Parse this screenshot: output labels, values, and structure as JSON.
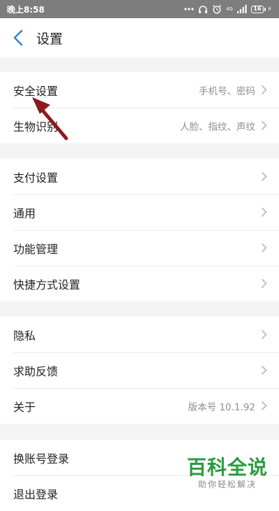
{
  "status_bar": {
    "time": "晚上8:58",
    "battery": "16",
    "network": "4G"
  },
  "header": {
    "title": "设置"
  },
  "groups": [
    {
      "items": [
        {
          "label": "安全设置",
          "value": "手机号、密码"
        },
        {
          "label": "生物识别",
          "value": "人脸、指纹、声纹"
        }
      ]
    },
    {
      "items": [
        {
          "label": "支付设置",
          "value": ""
        },
        {
          "label": "通用",
          "value": ""
        },
        {
          "label": "功能管理",
          "value": ""
        },
        {
          "label": "快捷方式设置",
          "value": ""
        }
      ]
    },
    {
      "items": [
        {
          "label": "隐私",
          "value": ""
        },
        {
          "label": "求助反馈",
          "value": ""
        },
        {
          "label": "关于",
          "value": "版本号 10.1.92"
        }
      ]
    },
    {
      "items": [
        {
          "label": "换账号登录",
          "value": ""
        },
        {
          "label": "退出登录",
          "value": ""
        }
      ]
    }
  ],
  "watermark": {
    "main": "百科全说",
    "sub": "助你轻松解决"
  },
  "colors": {
    "accent": "#2f7fd8",
    "annotation_arrow": "#8b1a1a",
    "watermark_green": "#2b9a3e",
    "background": "#f4f4f4",
    "status_bar": "#7d7d7d"
  }
}
